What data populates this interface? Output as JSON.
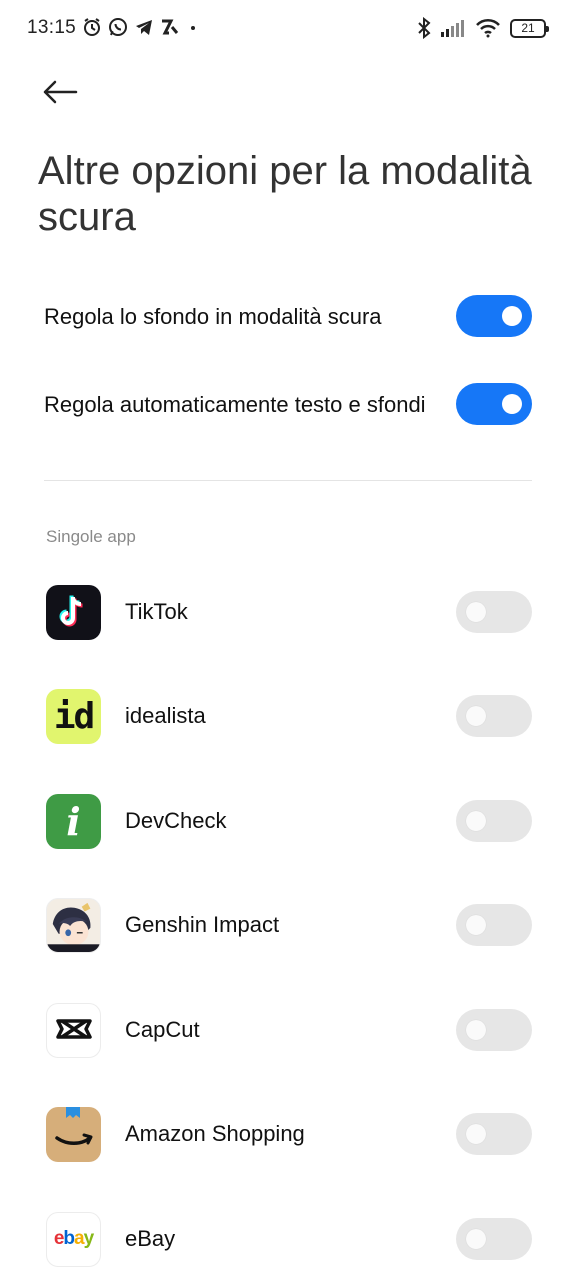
{
  "status_bar": {
    "time": "13:15",
    "battery": "21",
    "left_icons": [
      "alarm-icon",
      "whatsapp-icon",
      "telegram-icon",
      "app-notification-icon",
      "dot-icon"
    ],
    "right_icons": [
      "bluetooth-icon",
      "signal-icon",
      "wifi-icon",
      "battery-icon"
    ]
  },
  "header": {
    "back_icon": "arrow-left-icon",
    "title": "Altre opzioni per la modalità scura"
  },
  "settings": [
    {
      "label": "Regola lo sfondo in modalità scura",
      "enabled": true
    },
    {
      "label": "Regola automaticamente testo e sfondi",
      "enabled": true
    }
  ],
  "section_label": "Singole app",
  "apps": [
    {
      "name": "TikTok",
      "icon": "tiktok-icon",
      "enabled": false
    },
    {
      "name": "idealista",
      "icon": "idealista-icon",
      "icon_text": "id",
      "enabled": false
    },
    {
      "name": "DevCheck",
      "icon": "devcheck-icon",
      "icon_text": "i",
      "enabled": false
    },
    {
      "name": "Genshin Impact",
      "icon": "genshin-impact-icon",
      "enabled": false
    },
    {
      "name": "CapCut",
      "icon": "capcut-icon",
      "enabled": false
    },
    {
      "name": "Amazon Shopping",
      "icon": "amazon-shopping-icon",
      "enabled": false
    },
    {
      "name": "eBay",
      "icon": "ebay-icon",
      "icon_text": [
        "e",
        "b",
        "a",
        "y"
      ],
      "enabled": false
    }
  ],
  "colors": {
    "toggle_on": "#1677f7",
    "toggle_off": "#e6e6e6",
    "section_label": "#8a8a8a"
  }
}
